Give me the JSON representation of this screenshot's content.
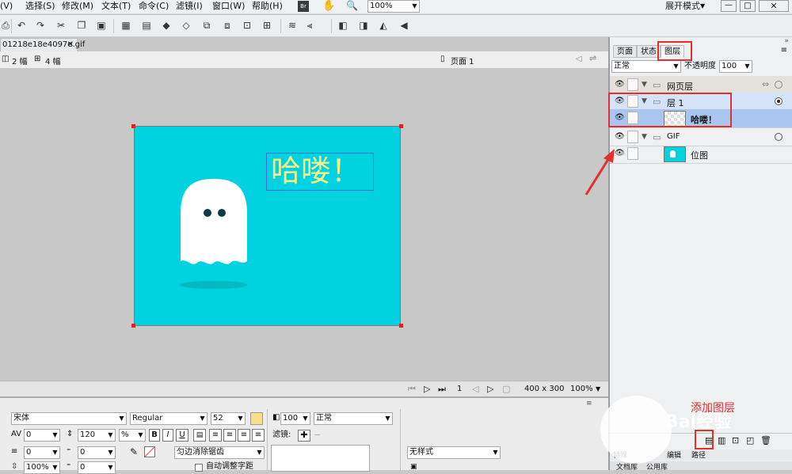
{
  "menubar": {
    "items": [
      "(V)",
      "选择(S)",
      "修改(M)",
      "文本(T)",
      "命令(C)",
      "滤镜(I)",
      "窗口(W)",
      "帮助(H)"
    ],
    "zoom": "100%",
    "workspace": "展开模式"
  },
  "doc": {
    "tab": "01218e18e4097e.gif",
    "view2": "2 幅",
    "view4": "4 幅",
    "page": "页面 1"
  },
  "canvas": {
    "text": "哈喽！",
    "bg_color": "#00d3df",
    "text_color": "#f5ef8a"
  },
  "status": {
    "frame": "1",
    "size": "400 x 300",
    "zoom": "100%"
  },
  "layers_panel": {
    "tabs": [
      "页面",
      "状态",
      "图层"
    ],
    "blend": "正常",
    "opacity_label": "不透明度",
    "opacity": "100",
    "rows": [
      {
        "name": "网页层",
        "kind": "folder"
      },
      {
        "name": "层 1",
        "kind": "folder"
      },
      {
        "name": "哈喽！",
        "kind": "text"
      },
      {
        "name": "GIF",
        "kind": "folder"
      },
      {
        "name": "位图",
        "kind": "bitmap"
      }
    ],
    "bottom_tabs": [
      "特殊",
      "编辑",
      "路径"
    ],
    "lib_tabs": [
      "文档库",
      "公用库"
    ]
  },
  "props": {
    "font": "宋体",
    "style": "Regular",
    "size": "52",
    "kerning": "0",
    "leading": "120",
    "leading_unit": "%",
    "indent": "0",
    "space_before": "0",
    "scale": "100%",
    "space_after": "0",
    "opacity": "100",
    "blend": "正常",
    "filters": "滤镜:",
    "aa": "匀边消除锯齿",
    "auto_kern": "自动调整字距",
    "style_sel": "无样式"
  },
  "watermark": {
    "text": "添加图层",
    "brand": "Bai经验"
  }
}
